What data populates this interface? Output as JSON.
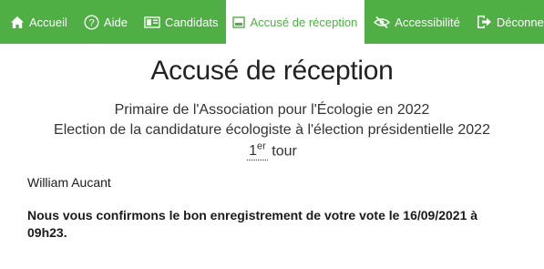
{
  "nav": {
    "items": [
      {
        "label": "Accueil",
        "icon": "home-icon"
      },
      {
        "label": "Aide",
        "icon": "help-icon"
      },
      {
        "label": "Candidats",
        "icon": "candidates-icon"
      },
      {
        "label": "Accusé de réception",
        "icon": "receipt-icon",
        "active": true
      },
      {
        "label": "Accessibilité",
        "icon": "eye-slash-icon"
      },
      {
        "label": "Déconnexion",
        "icon": "logout-icon"
      }
    ]
  },
  "page": {
    "title": "Accusé de réception",
    "subtitle_line1": "Primaire de l'Association pour l'Écologie en 2022",
    "subtitle_line2": "Election de la candidature écologiste à l'élection présidentielle 2022",
    "round_number": "1",
    "round_suffix": "er",
    "round_word": "tour",
    "voter_name": "William Aucant",
    "confirmation": "Nous vous confirmons le bon enregistrement de votre vote le 16/09/2021 à 09h23."
  },
  "colors": {
    "accent": "#4faf45",
    "background": "#ffffff",
    "text": "#1a1a1a"
  }
}
